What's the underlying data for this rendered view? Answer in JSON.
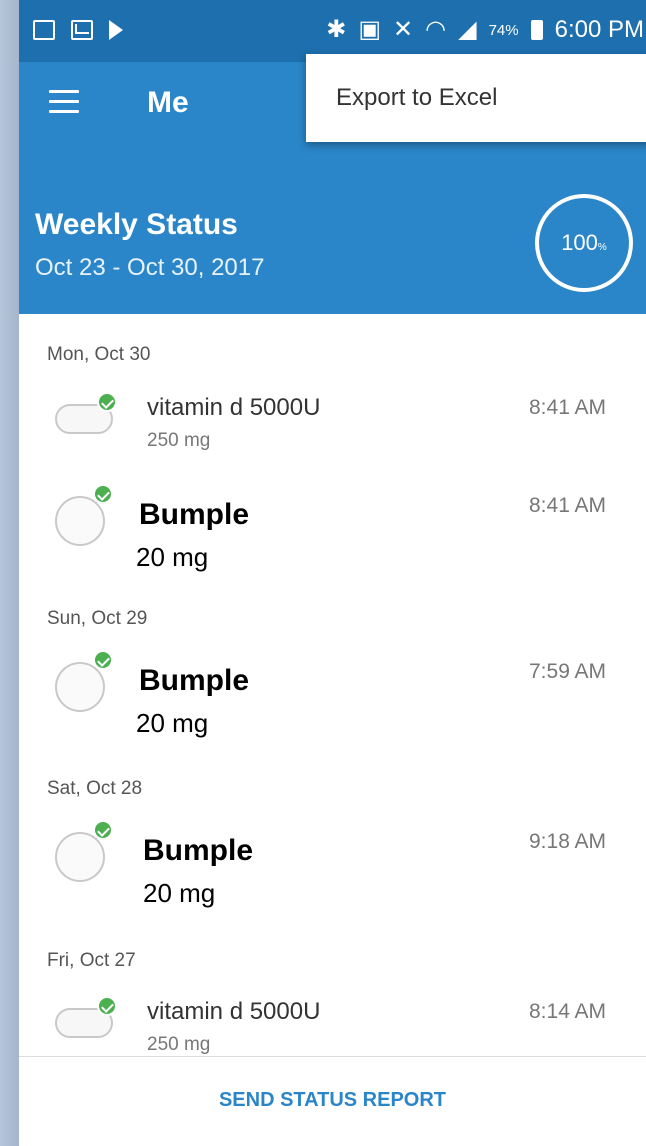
{
  "status_bar": {
    "battery_percent": "74%",
    "time": "6:00 PM",
    "icons": [
      "gallery-icon",
      "mail-icon",
      "play-icon",
      "bluetooth-icon",
      "nfc-icon",
      "mute-icon",
      "wifi-icon",
      "signal-icon",
      "battery-icon"
    ]
  },
  "app_bar": {
    "title": "Me"
  },
  "menu": {
    "items": [
      {
        "label": "Export to Excel"
      }
    ]
  },
  "weekly_status": {
    "title": "Weekly Status",
    "date_range": "Oct 23 - Oct 30, 2017",
    "progress_label": "100",
    "progress_percent": 100
  },
  "days": [
    {
      "header": "Mon, Oct 30",
      "meds": [
        {
          "name": "vitamin d 5000U",
          "dose": "250 mg",
          "time": "8:41 AM",
          "shape": "oval",
          "taken": true
        },
        {
          "name": "Bumple",
          "dose": "20 mg",
          "time": "8:41 AM",
          "shape": "round",
          "taken": true
        }
      ]
    },
    {
      "header": "Sun, Oct 29",
      "meds": [
        {
          "name": "Bumple",
          "dose": "20 mg",
          "time": "7:59 AM",
          "shape": "round",
          "taken": true
        }
      ]
    },
    {
      "header": "Sat, Oct 28",
      "meds": [
        {
          "name": "Bumple",
          "dose": "20 mg",
          "time": "9:18 AM",
          "shape": "round",
          "taken": true
        }
      ]
    },
    {
      "header": "Fri, Oct 27",
      "meds": [
        {
          "name": "vitamin d 5000U",
          "dose": "250 mg",
          "time": "8:14 AM",
          "shape": "oval",
          "taken": true
        }
      ]
    }
  ],
  "footer": {
    "action_label": "SEND STATUS REPORT"
  },
  "colors": {
    "primary": "#2a86c9",
    "status_bar": "#1d6fae",
    "taken_check": "#4caf50"
  }
}
